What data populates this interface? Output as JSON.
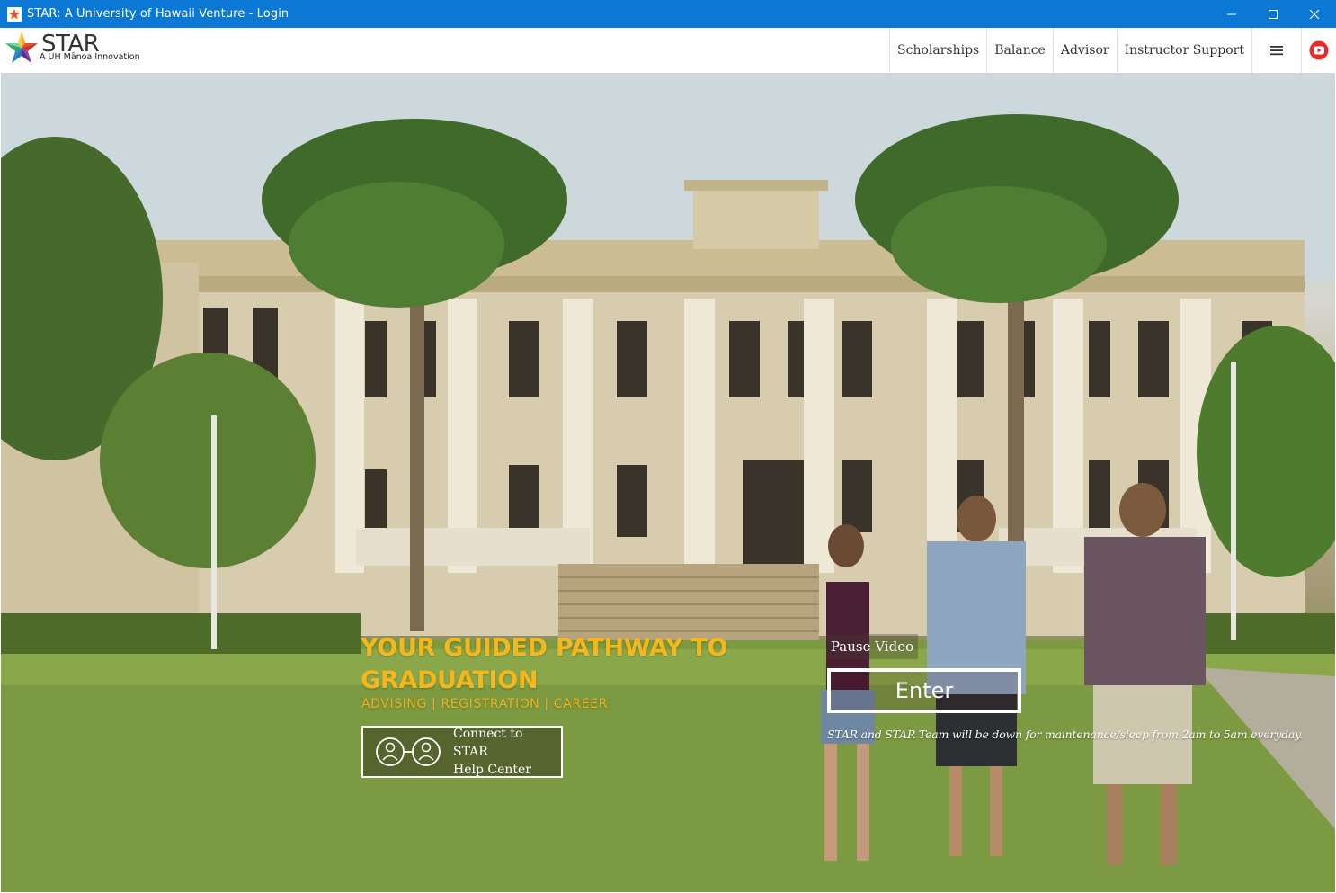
{
  "window": {
    "title": "STAR: A University of Hawaii Venture - Login",
    "controls": [
      "minimize-icon",
      "maximize-icon",
      "close-icon"
    ],
    "title_bar_color": "#0b78d6"
  },
  "header": {
    "logo": {
      "brand": "STAR",
      "tagline": "A UH Mānoa Innovation"
    },
    "nav": {
      "scholarships": "Scholarships",
      "balance": "Balance",
      "advisor": "Advisor",
      "instructor_support": "Instructor Support",
      "menu_icon": "hamburger-menu-icon",
      "youtube_icon": "youtube-icon"
    }
  },
  "hero": {
    "headline": "YOUR GUIDED PATHWAY TO GRADUATION",
    "subline": "ADVISING | REGISTRATION | CAREER",
    "help_button": {
      "line1": "Connect to STAR",
      "line2": "Help Center",
      "icon": "connect-people-icon"
    },
    "pause_button": "Pause Video",
    "enter_button": "Enter",
    "maintenance_notice": "STAR and STAR Team will be down for maintenance/sleep from 2am to 5am everyday.",
    "accent_color": "#f5b71e"
  }
}
